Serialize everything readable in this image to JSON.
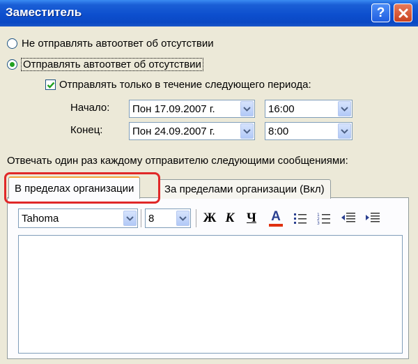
{
  "window": {
    "title": "Заместитель",
    "help_symbol": "?",
    "close_symbol": "✕",
    "colors": {
      "titlebar": "#0a48c4",
      "dialog_bg": "#ece9d8",
      "highlight": "#e02828"
    }
  },
  "options": {
    "no_reply_label": "Не отправлять автоответ об отсутствии",
    "send_reply_label": "Отправлять автоответ об отсутствии",
    "selected": "send_reply",
    "period_checkbox_label": "Отправлять только в течение следующего периода:",
    "period_checked": true
  },
  "period": {
    "start_label": "Начало:",
    "start_date": "Пон 17.09.2007 г.",
    "start_time": "16:00",
    "end_label": "Конец:",
    "end_date": "Пон 24.09.2007 г.",
    "end_time": "8:00"
  },
  "reply_label": "Отвечать один раз каждому отправителю следующими сообщениями:",
  "tabs": [
    {
      "label": "В пределах организации",
      "active": true
    },
    {
      "label": "За пределами организации (Вкл)",
      "active": false
    }
  ],
  "toolbar": {
    "font": "Tahoma",
    "size": "8",
    "bold": "Ж",
    "italic": "К",
    "underline": "Ч",
    "font_color": "A",
    "font_color_swatch": "#e03010",
    "icons": [
      "bullets-icon",
      "numbering-icon",
      "decrease-indent-icon",
      "increase-indent-icon"
    ]
  },
  "editor": {
    "value": ""
  }
}
